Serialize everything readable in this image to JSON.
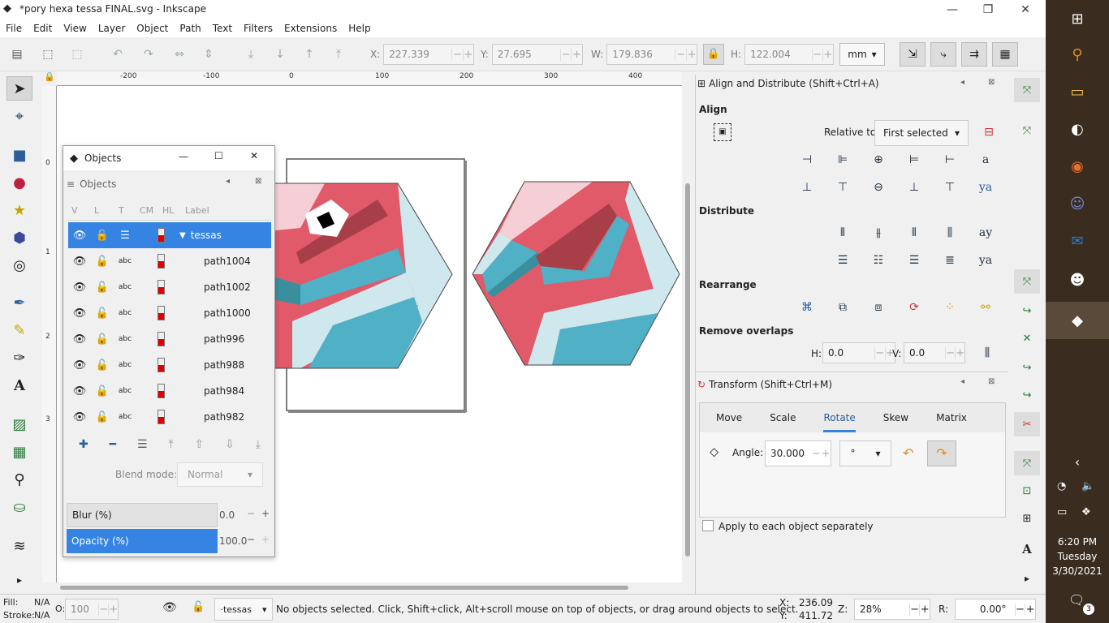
{
  "window": {
    "title": "*pory hexa tessa FINAL.svg - Inkscape"
  },
  "menu": [
    "File",
    "Edit",
    "View",
    "Layer",
    "Object",
    "Path",
    "Text",
    "Filters",
    "Extensions",
    "Help"
  ],
  "toolbar": {
    "x_label": "X:",
    "x_value": "227.339",
    "y_label": "Y:",
    "y_value": "27.695",
    "w_label": "W:",
    "w_value": "179.836",
    "h_label": "H:",
    "h_value": "122.004",
    "unit": "mm"
  },
  "ruler": {
    "labels": [
      "-200",
      "-100",
      "0",
      "100",
      "200",
      "300",
      "400"
    ],
    "vlabels": [
      "0",
      "1",
      "2",
      "3"
    ]
  },
  "objects_window": {
    "title": "Objects",
    "tab": "Objects",
    "columns": [
      "V",
      "L",
      "T",
      "CM",
      "HL",
      "Label"
    ],
    "rows": [
      {
        "label": "tessas",
        "selected": true
      },
      {
        "label": "path1004"
      },
      {
        "label": "path1002"
      },
      {
        "label": "path1000"
      },
      {
        "label": "path996"
      },
      {
        "label": "path988"
      },
      {
        "label": "path984"
      },
      {
        "label": "path982"
      }
    ],
    "blend_label": "Blend mode:",
    "blend_value": "Normal",
    "blur_label": "Blur (%)",
    "blur_value": "0.0",
    "opacity_label": "Opacity (%)",
    "opacity_value": "100.0"
  },
  "align_panel": {
    "title": "Align and Distribute (Shift+Ctrl+A)",
    "align": "Align",
    "relative_label": "Relative to:",
    "relative_value": "First selected",
    "distribute": "Distribute",
    "rearrange": "Rearrange",
    "remove_overlaps": "Remove overlaps",
    "h_label": "H:",
    "h_value": "0.0",
    "v_label": "V:",
    "v_value": "0.0"
  },
  "transform_panel": {
    "title": "Transform (Shift+Ctrl+M)",
    "tabs": [
      "Move",
      "Scale",
      "Rotate",
      "Skew",
      "Matrix"
    ],
    "active_tab": "Rotate",
    "angle_label": "Angle:",
    "angle_value": "30.000",
    "angle_unit": "°",
    "apply_each": "Apply to each object separately"
  },
  "status": {
    "fill_label": "Fill:",
    "fill_value": "N/A",
    "stroke_label": "Stroke:",
    "stroke_value": "N/A",
    "opacity_label": "O:",
    "opacity_value": "100",
    "layer": "·tessas",
    "message": "No objects selected. Click, Shift+click, Alt+scroll mouse on top of objects, or drag around objects to select.",
    "cx_label": "X:",
    "cx_value": "236.09",
    "cy_label": "Y:",
    "cy_value": "411.72",
    "zoom_label": "Z:",
    "zoom_value": "28%",
    "rot_label": "R:",
    "rot_value": "0.00°"
  },
  "taskbar": {
    "time": "6:20 PM",
    "day": "Tuesday",
    "date": "3/30/2021",
    "notif_count": "3"
  },
  "colors": {
    "pink_light": "#f6cfd6",
    "red": "#e05a6a",
    "dark_red": "#a83e48",
    "teal": "#4fb0c6",
    "teal_dark": "#3a8f9e",
    "light_blue": "#cfe8ee",
    "accent": "#3584e4"
  }
}
